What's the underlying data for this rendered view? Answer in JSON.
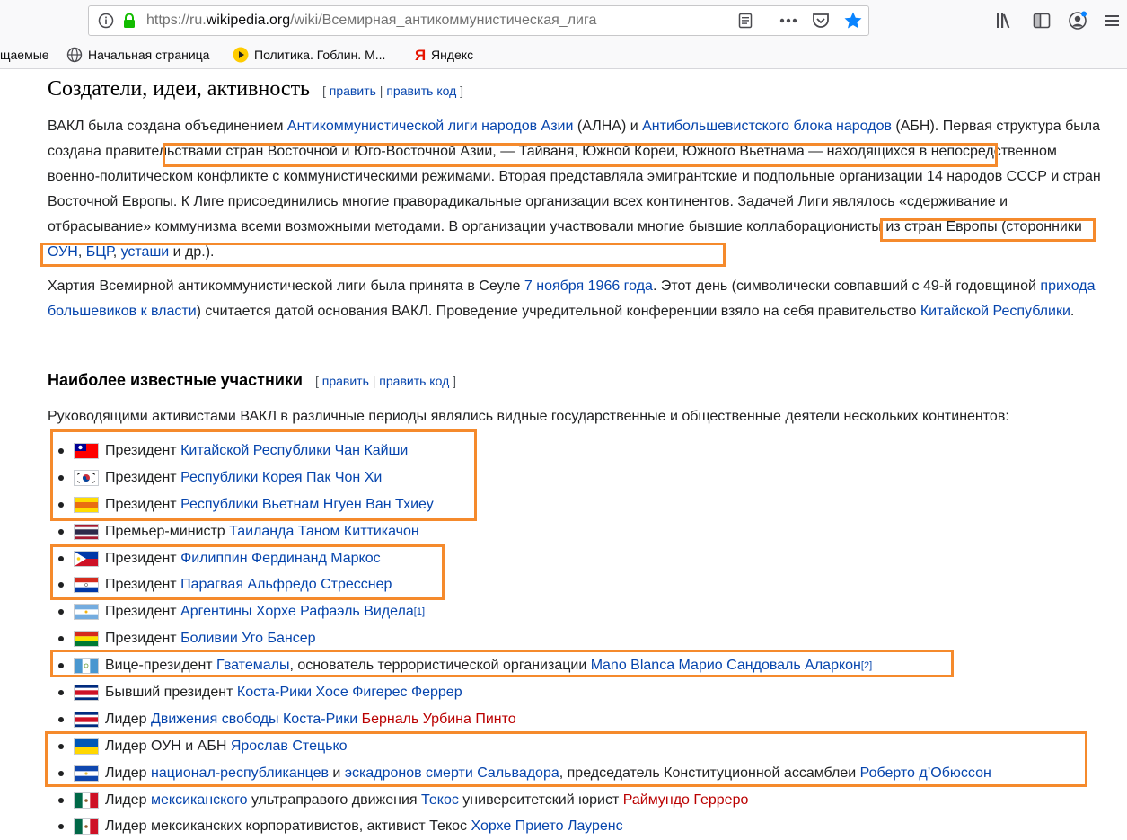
{
  "browser": {
    "url_prefix": "https://ru.",
    "url_domain": "wikipedia.org",
    "url_path": "/wiki/Всемирная_антикоммунистическая_лига",
    "bookmarks": [
      {
        "label": "щаемые",
        "icon": "none"
      },
      {
        "label": "Начальная страница",
        "icon": "globe-icon"
      },
      {
        "label": "Политика. Гоблин. М...",
        "icon": "play-icon"
      },
      {
        "label": "Яндекс",
        "icon": "yandex-icon"
      }
    ]
  },
  "section1": {
    "title": "Создатели, идеи, активность",
    "edit_open": "[",
    "edit": "править",
    "edit_sep": "|",
    "edit_code": "править код",
    "edit_close": "]",
    "p1": {
      "t1": "ВАКЛ была создана объединением ",
      "l1": "Антикоммунистической лиги народов Азии",
      "t2": " (АЛНА) и ",
      "l2": "Антибольшевистского блока народов",
      "t3": " (АБН). Первая структура была ",
      "t4": "создана правительствами стран Восточной и Юго-Восточной Азии, — Тайваня, Южной Кореи, Южного Вьетнама",
      "t5": " — находящихся в непосредственном военно-политическом конфликте с коммунистическими режимами. Вторая представляла эмигрантские и подпольные организации 14 народов СССР и стран Восточной Европы. К Лиге присоединились многие праворадикальные организации всех континентов. Задачей Лиги являлось «сдерживание и отбрасывание» коммунизма всеми возможными методами. ",
      "t6": "В организации участвовали многие бывшие коллаборационисты из стран Европы (сторонники ",
      "l3": "ОУН",
      "t7": ", ",
      "l4": "БЦР",
      "t8": ", ",
      "l5": "усташи",
      "t9": " и др.)."
    },
    "p2": {
      "t1": "Хартия Всемирной антикоммунистической лиги была принята в Сеуле ",
      "l1": "7 ноября",
      "t2": " ",
      "l2": "1966 года",
      "t3": ". Этот день (символически совпавший с 49-й годовщиной ",
      "l3": "прихода большевиков к власти",
      "t4": ") считается датой основания ВАКЛ. Проведение учредительной конференции взяло на себя правительство ",
      "l4": "Китайской Республики",
      "t5": "."
    }
  },
  "section2": {
    "title": "Наиболее известные участники",
    "intro": "Руководящими активистами ВАКЛ в различные периоды являлись видные государственные и общественные деятели нескольких континентов:",
    "members": [
      {
        "flag": "taiwan",
        "parts": [
          {
            "t": "Президент "
          },
          {
            "l": "Китайской Республики"
          },
          {
            "t": " "
          },
          {
            "l": "Чан Кайши"
          }
        ]
      },
      {
        "flag": "south-korea",
        "parts": [
          {
            "t": "Президент "
          },
          {
            "l": "Республики Корея"
          },
          {
            "t": " "
          },
          {
            "l": "Пак Чон Хи"
          }
        ]
      },
      {
        "flag": "south-vietnam",
        "parts": [
          {
            "t": "Президент "
          },
          {
            "l": "Республики Вьетнам"
          },
          {
            "t": " "
          },
          {
            "l": "Нгуен Ван Тхиеу"
          }
        ]
      },
      {
        "flag": "thailand",
        "parts": [
          {
            "t": "Премьер-министр "
          },
          {
            "l": "Таиланда"
          },
          {
            "t": " "
          },
          {
            "l": "Таном Киттикачон"
          }
        ]
      },
      {
        "flag": "philippines",
        "parts": [
          {
            "t": "Президент "
          },
          {
            "l": "Филиппин"
          },
          {
            "t": " "
          },
          {
            "l": "Фердинанд Маркос"
          }
        ]
      },
      {
        "flag": "paraguay",
        "parts": [
          {
            "t": "Президент "
          },
          {
            "l": "Парагвая"
          },
          {
            "t": " "
          },
          {
            "l": "Альфредо Стресснер"
          }
        ]
      },
      {
        "flag": "argentina",
        "parts": [
          {
            "t": "Президент "
          },
          {
            "l": "Аргентины"
          },
          {
            "t": " "
          },
          {
            "l": "Хорхе Рафаэль Видела"
          },
          {
            "s": "[1]"
          }
        ]
      },
      {
        "flag": "bolivia",
        "parts": [
          {
            "t": "Президент "
          },
          {
            "l": "Боливии"
          },
          {
            "t": " "
          },
          {
            "l": "Уго Бансер"
          }
        ]
      },
      {
        "flag": "guatemala",
        "parts": [
          {
            "t": "Вице-президент "
          },
          {
            "l": "Гватемалы"
          },
          {
            "t": ", основатель террористической организации "
          },
          {
            "l": "Mano Blanca"
          },
          {
            "t": " "
          },
          {
            "l": "Марио Сандоваль Аларкон"
          },
          {
            "s": "[2]"
          }
        ]
      },
      {
        "flag": "costa-rica",
        "parts": [
          {
            "t": "Бывший президент "
          },
          {
            "l": "Коста-Рики"
          },
          {
            "t": " "
          },
          {
            "l": "Хосе Фигерес Феррер"
          }
        ]
      },
      {
        "flag": "costa-rica",
        "parts": [
          {
            "t": "Лидер "
          },
          {
            "l": "Движения свободы Коста-Рики"
          },
          {
            "t": " "
          },
          {
            "r": "Берналь Урбина Пинто"
          }
        ]
      },
      {
        "flag": "ukraine",
        "parts": [
          {
            "t": "Лидер ОУН и АБН "
          },
          {
            "l": "Ярослав Стецько"
          }
        ]
      },
      {
        "flag": "el-salvador",
        "parts": [
          {
            "t": "Лидер "
          },
          {
            "l": "национал-республиканцев"
          },
          {
            "t": " и "
          },
          {
            "l": "эскадронов смерти Сальвадора"
          },
          {
            "t": ", председатель Конституционной ассамблеи "
          },
          {
            "l": "Роберто д’Обюссон"
          }
        ]
      },
      {
        "flag": "mexico",
        "parts": [
          {
            "t": "Лидер "
          },
          {
            "l": "мексиканского"
          },
          {
            "t": " ультраправого движения "
          },
          {
            "l": "Текос"
          },
          {
            "t": " университетский юрист "
          },
          {
            "r": "Раймундо Герреро"
          }
        ]
      },
      {
        "flag": "mexico",
        "parts": [
          {
            "t": "Лидер мексиканских корпоративистов, активист Текос "
          },
          {
            "l": "Хорхе Прието Лауренс"
          }
        ]
      }
    ]
  },
  "highlight_color": "#f58a2c",
  "link_color": "#0645ad",
  "redlink_color": "#ba0000"
}
